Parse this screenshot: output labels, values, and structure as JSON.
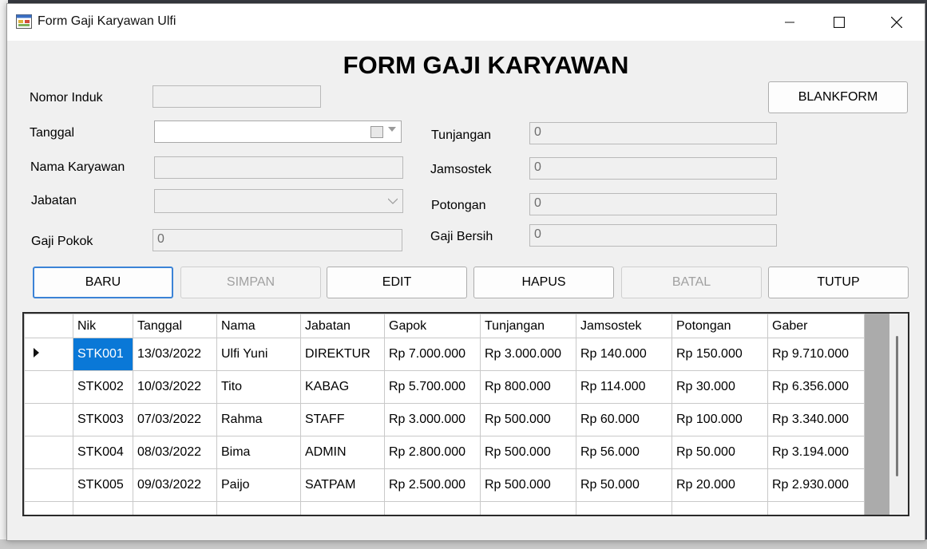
{
  "window": {
    "title": "Form Gaji Karyawan Ulfi",
    "minimize_glyph": "─",
    "maximize_glyph": "☐",
    "close_glyph": "✕"
  },
  "form": {
    "heading": "FORM GAJI KARYAWAN",
    "labels": {
      "nomor_induk": "Nomor Induk",
      "tanggal": "Tanggal",
      "nama_karyawan": "Nama Karyawan",
      "jabatan": "Jabatan",
      "gaji_pokok": "Gaji Pokok",
      "tunjangan": "Tunjangan",
      "jamsostek": "Jamsostek",
      "potongan": "Potongan",
      "gaji_bersih": "Gaji Bersih"
    },
    "values": {
      "nomor_induk": "",
      "tanggal": "",
      "nama_karyawan": "",
      "jabatan": "",
      "gaji_pokok": "0",
      "tunjangan": "0",
      "jamsostek": "0",
      "potongan": "0",
      "gaji_bersih": "0"
    }
  },
  "buttons": {
    "blankform": "BLANKFORM",
    "baru": "BARU",
    "simpan": "SIMPAN",
    "edit": "EDIT",
    "hapus": "HAPUS",
    "batal": "BATAL",
    "tutup": "TUTUP"
  },
  "grid": {
    "columns": [
      "Nik",
      "Tanggal",
      "Nama",
      "Jabatan",
      "Gapok",
      "Tunjangan",
      "Jamsostek",
      "Potongan",
      "Gaber"
    ],
    "rows": [
      [
        "STK001",
        "13/03/2022",
        "Ulfi Yuni",
        "DIREKTUR",
        "Rp 7.000.000",
        "Rp 3.000.000",
        "Rp 140.000",
        "Rp 150.000",
        "Rp 9.710.000"
      ],
      [
        "STK002",
        "10/03/2022",
        "Tito",
        "KABAG",
        "Rp 5.700.000",
        "Rp 800.000",
        "Rp 114.000",
        "Rp 30.000",
        "Rp 6.356.000"
      ],
      [
        "STK003",
        "07/03/2022",
        "Rahma",
        "STAFF",
        "Rp 3.000.000",
        "Rp 500.000",
        "Rp 60.000",
        "Rp 100.000",
        "Rp 3.340.000"
      ],
      [
        "STK004",
        "08/03/2022",
        "Bima",
        "ADMIN",
        "Rp 2.800.000",
        "Rp 500.000",
        "Rp 56.000",
        "Rp 50.000",
        "Rp 3.194.000"
      ],
      [
        "STK005",
        "09/03/2022",
        "Paijo",
        "SATPAM",
        "Rp 2.500.000",
        "Rp 500.000",
        "Rp 50.000",
        "Rp 20.000",
        "Rp 2.930.000"
      ]
    ]
  }
}
